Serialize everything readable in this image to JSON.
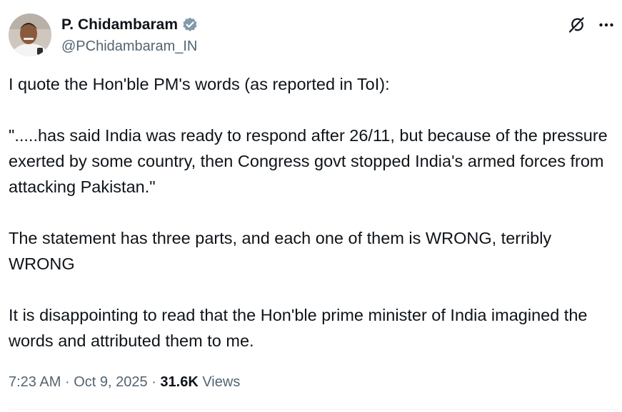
{
  "author": {
    "display_name": "P. Chidambaram",
    "handle": "@PChidambaram_IN",
    "verified": true,
    "verified_color": "#829aab"
  },
  "tweet": {
    "paragraphs": [
      "I quote the Hon'ble PM's words (as reported in ToI):",
      "\".....has said India was ready to respond after 26/11, but because of the pressure exerted by some country, then Congress govt stopped India's armed forces from attacking Pakistan.\"",
      "The statement has three parts, and each one of them is WRONG, terribly WRONG",
      "It is disappointing to read that the Hon'ble prime minister of India imagined the words and attributed them to me."
    ]
  },
  "meta": {
    "time": "7:23 AM",
    "separator": "·",
    "date": "Oct 9, 2025",
    "views_count": "31.6K",
    "views_label": "Views"
  },
  "icons": {
    "grok": "grok-icon",
    "more": "more-horizontal-icon",
    "verified": "verified-badge-icon"
  },
  "colors": {
    "text_primary": "#0f1419",
    "text_secondary": "#536471",
    "divider": "#eff3f4"
  }
}
